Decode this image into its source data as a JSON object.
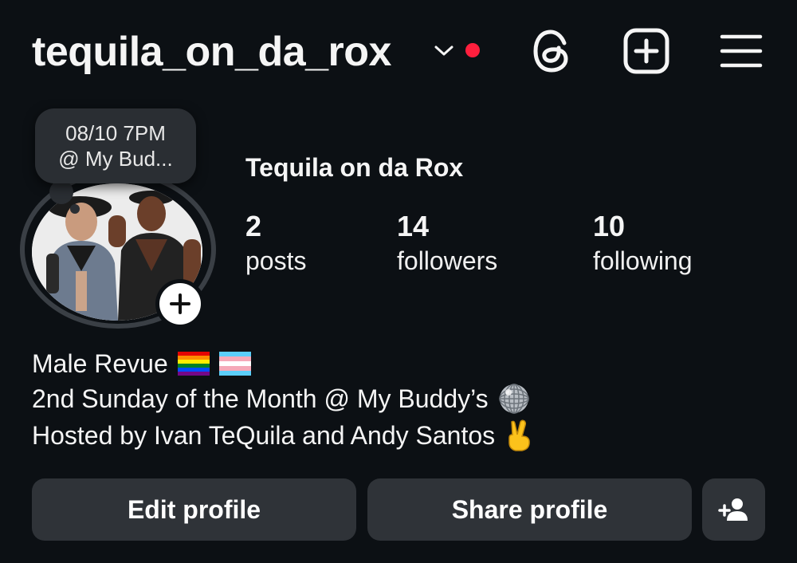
{
  "header": {
    "username": "tequila_on_da_rox",
    "notification_color": "#ff1f3d",
    "icons": [
      "chevron-down-icon",
      "threads-icon",
      "create-plus-icon",
      "menu-icon"
    ]
  },
  "note": {
    "line1": "08/10 7PM",
    "line2": "@ My Bud..."
  },
  "profile": {
    "display_name": "Tequila on da Rox",
    "stats": {
      "posts": {
        "count": "2",
        "label": "posts"
      },
      "followers": {
        "count": "14",
        "label": "followers"
      },
      "following": {
        "count": "10",
        "label": "following"
      }
    }
  },
  "bio": {
    "line1": "Male Revue",
    "line2": "2nd Sunday of the Month @ My Buddy’s",
    "line3": "Hosted by Ivan TeQuila and Andy Santos",
    "emojis": [
      "rainbow-flag",
      "transgender-flag",
      "mirror-ball",
      "victory-hand"
    ]
  },
  "actions": {
    "edit_profile": "Edit profile",
    "share_profile": "Share profile",
    "discover_icon": "add-person-icon"
  }
}
